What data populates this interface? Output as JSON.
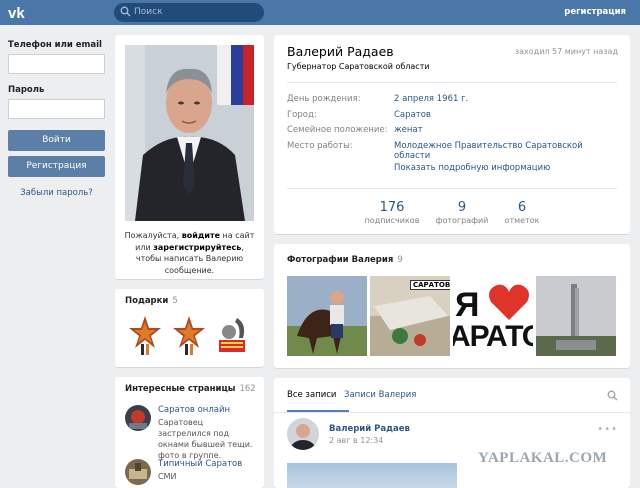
{
  "header": {
    "search_placeholder": "Поиск",
    "register_label": "регистрация"
  },
  "login": {
    "phone_label": "Телефон или email",
    "password_label": "Пароль",
    "login_button": "Войти",
    "register_button": "Регистрация",
    "forgot_link": "Забыли пароль?"
  },
  "photo_note": {
    "part1": "Пожалуйста, ",
    "login_word": "войдите",
    "part2": " на сайт или ",
    "register_word": "зарегистрируйтесь",
    "part3": ", чтобы написать Валерию сообщение."
  },
  "gifts": {
    "title": "Подарки",
    "count": "5"
  },
  "pages": {
    "title": "Интересные страницы",
    "count": "162",
    "items": [
      {
        "name": "Саратов онлайн",
        "desc": "Саратовец застрелился под окнами бывшей тещи. фото в группе."
      },
      {
        "name": "Типичный Саратов",
        "desc": "СМИ"
      }
    ]
  },
  "profile": {
    "name": "Валерий Радаев",
    "status": "Губернатор Саратовской области",
    "last_seen": "заходил 57 минут назад",
    "info": [
      {
        "label": "День рождения:",
        "value": "2 апреля 1961 г."
      },
      {
        "label": "Город:",
        "value": "Саратов"
      },
      {
        "label": "Семейное положение:",
        "value": "женат"
      },
      {
        "label": "Место работы:",
        "value": "Молодежное Правительство Саратовской области"
      }
    ],
    "more_link": "Показать подробную информацию",
    "stats": [
      {
        "num": "176",
        "label": "подписчиков"
      },
      {
        "num": "9",
        "label": "фотографий"
      },
      {
        "num": "6",
        "label": "отметок"
      }
    ]
  },
  "photos": {
    "title": "Фотографии Валерия",
    "count": "9",
    "sign_saratov": "САРАТОВ",
    "love_letter": "Я",
    "love_word": "АРАТО"
  },
  "wall": {
    "tabs": [
      "Все записи",
      "Записи Валерия"
    ],
    "post_author": "Валерий Радаев",
    "post_date": "2 авг в 12:34"
  },
  "watermark": "YAPLAKAL.COM",
  "colors": {
    "header_bg": "#4a76a8",
    "link": "#2a5885",
    "button": "#5b7fa6",
    "page_bg": "#edeef0"
  },
  "icons": [
    "vk-logo-icon",
    "search-icon",
    "heart-icon",
    "gift-icon",
    "more-dots-icon"
  ]
}
